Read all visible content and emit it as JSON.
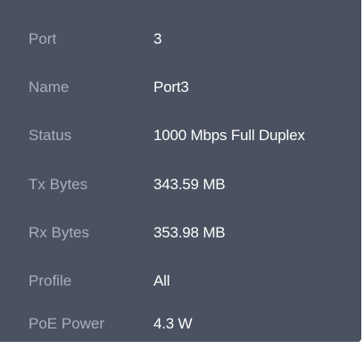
{
  "details": {
    "rows": [
      {
        "label": "Port",
        "value": "3"
      },
      {
        "label": "Name",
        "value": "Port3"
      },
      {
        "label": "Status",
        "value": "1000 Mbps Full Duplex"
      },
      {
        "label": "Tx Bytes",
        "value": "343.59 MB"
      },
      {
        "label": "Rx Bytes",
        "value": "353.98 MB"
      },
      {
        "label": "Profile",
        "value": "All"
      },
      {
        "label": "PoE Power",
        "value": "4.3 W"
      }
    ]
  },
  "colors": {
    "panel_background": "#4a5160",
    "label_text": "#a8aebb",
    "value_text": "#ffffff"
  }
}
